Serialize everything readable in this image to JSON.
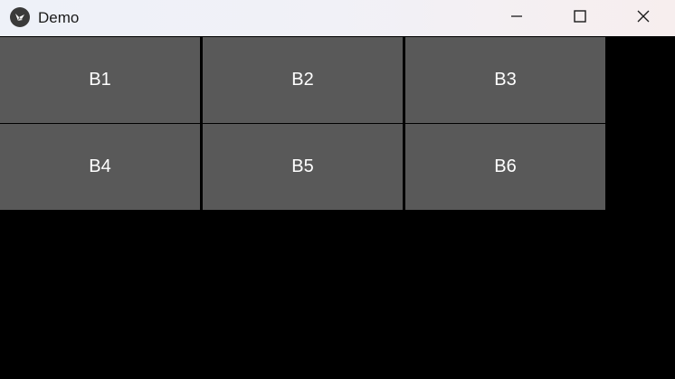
{
  "window": {
    "title": "Demo",
    "app_icon": "kivy-logo-icon",
    "controls": {
      "minimize_icon": "minimize-icon",
      "maximize_icon": "maximize-icon",
      "close_icon": "close-icon"
    }
  },
  "grid": {
    "buttons": [
      {
        "label": "B1"
      },
      {
        "label": "B2"
      },
      {
        "label": "B3"
      },
      {
        "label": "B4"
      },
      {
        "label": "B5"
      },
      {
        "label": "B6"
      }
    ]
  },
  "colors": {
    "button_bg": "#595959",
    "button_text": "#ffffff",
    "window_bg": "#000000"
  }
}
